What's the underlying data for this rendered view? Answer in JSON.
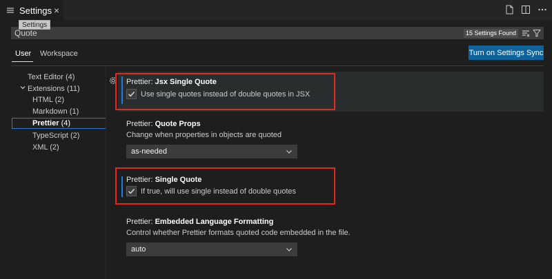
{
  "tab": {
    "label": "Settings",
    "close": "×"
  },
  "tooltip": "Settings",
  "search": {
    "value": "Quote",
    "found": "15 Settings Found"
  },
  "scopes": {
    "user": "User",
    "workspace": "Workspace"
  },
  "sync_button": "Turn on Settings Sync",
  "toc": {
    "text_editor": "Text Editor (4)",
    "extensions": "Extensions (11)",
    "html": "HTML (2)",
    "markdown": "Markdown (1)",
    "prettier_name": "Prettier",
    "prettier_count": "(4)",
    "typescript": "TypeScript (2)",
    "xml": "XML (2)"
  },
  "settings": {
    "jsx": {
      "category": "Prettier: ",
      "name": "Jsx Single Quote",
      "checkbox_label": "Use single quotes instead of double quotes in JSX",
      "checked": true
    },
    "quote_props": {
      "category": "Prettier: ",
      "name": "Quote Props",
      "description": "Change when properties in objects are quoted",
      "value": "as-needed"
    },
    "single_quote": {
      "category": "Prettier: ",
      "name": "Single Quote",
      "checkbox_label": "If true, will use single instead of double quotes",
      "checked": true
    },
    "embedded": {
      "category": "Prettier: ",
      "name": "Embedded Language Formatting",
      "description": "Control whether Prettier formats quoted code embedded in the file.",
      "value": "auto"
    }
  },
  "colors": {
    "accent": "#0e639c",
    "focus": "#2b79d6",
    "highlight": "#e02a1e"
  }
}
